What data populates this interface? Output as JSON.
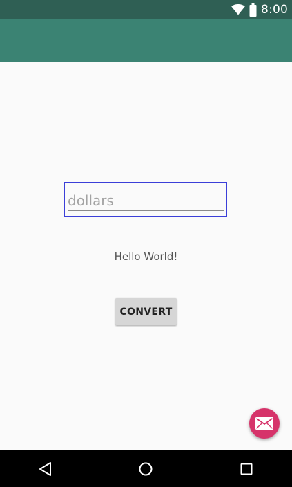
{
  "status_bar": {
    "time": "8:00",
    "icons": [
      "wifi-icon",
      "battery-icon"
    ],
    "background": "#2f5f54"
  },
  "app_bar": {
    "background": "#3b8373"
  },
  "form": {
    "dollars_placeholder": "dollars",
    "dollars_value": "",
    "hello_text": "Hello World!",
    "convert_label": "CONVERT"
  },
  "fab": {
    "icon": "email-icon",
    "color": "#d6336a"
  },
  "nav_bar": {
    "buttons": [
      "back-icon",
      "home-icon",
      "recents-icon"
    ]
  }
}
